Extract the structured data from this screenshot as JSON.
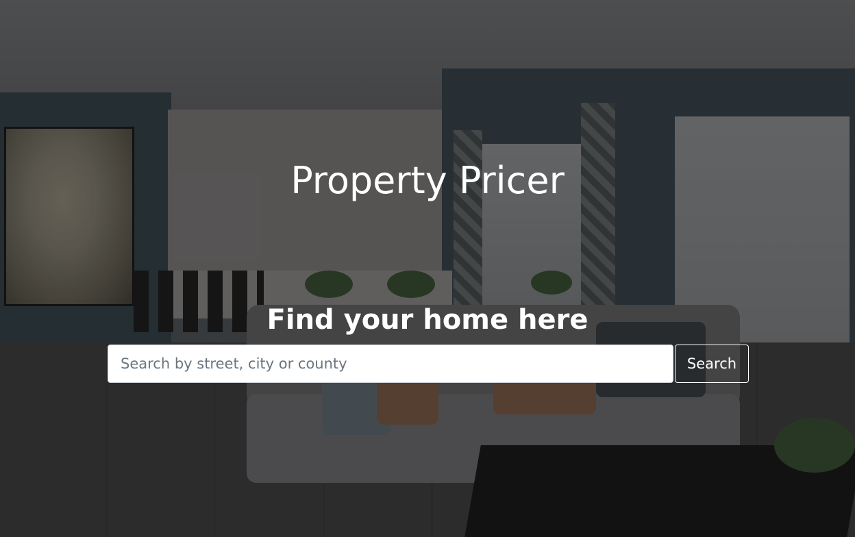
{
  "hero": {
    "title": "Property Pricer",
    "subtitle": "Find your home here",
    "background": "living-room-photo",
    "overlay_color": "#000000"
  },
  "search": {
    "placeholder": "Search by street, city or county",
    "value": "",
    "button_label": "Search"
  },
  "colors": {
    "text": "#ffffff",
    "input_background": "#ffffff",
    "placeholder": "#6c757d"
  }
}
